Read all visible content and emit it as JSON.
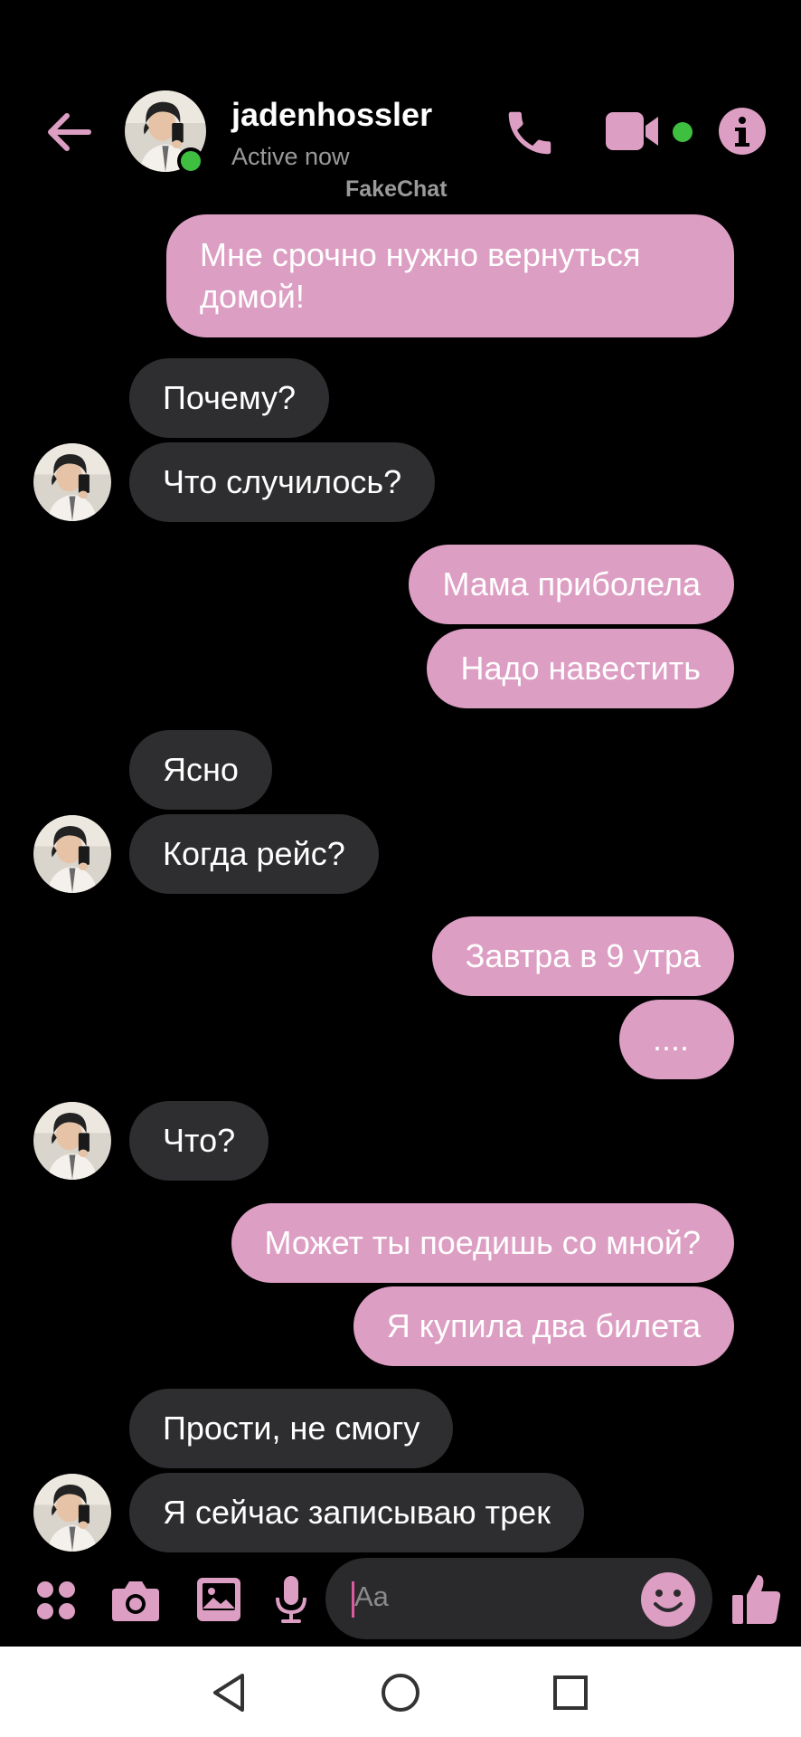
{
  "header": {
    "contact_name": "jadenhossler",
    "status": "Active now",
    "watermark": "FakeChat",
    "icons": [
      "back-arrow-icon",
      "phone-icon",
      "video-camera-icon",
      "info-icon"
    ]
  },
  "messages": [
    {
      "side": "out",
      "text": "Мне срочно нужно вернуться домой!"
    },
    {
      "side": "in",
      "text": "Почему?"
    },
    {
      "side": "in",
      "text": "Что случилось?"
    },
    {
      "side": "out",
      "text": "Мама приболела"
    },
    {
      "side": "out",
      "text": "Надо навестить"
    },
    {
      "side": "in",
      "text": "Ясно"
    },
    {
      "side": "in",
      "text": "Когда рейс?"
    },
    {
      "side": "out",
      "text": "Завтра в 9 утра"
    },
    {
      "side": "out",
      "text": "...."
    },
    {
      "side": "in",
      "text": "Что?"
    },
    {
      "side": "out",
      "text": "Может ты поедишь со мной?"
    },
    {
      "side": "out",
      "text": "Я купила два билета"
    },
    {
      "side": "in",
      "text": "Прости, не смогу"
    },
    {
      "side": "in",
      "text": "Я сейчас записываю трек"
    }
  ],
  "composer": {
    "placeholder": "Aa",
    "icons": [
      "apps-grid-icon",
      "camera-icon",
      "image-icon",
      "microphone-icon",
      "emoji-icon",
      "thumbs-up-icon"
    ]
  },
  "navbar": {
    "icons": [
      "nav-back-icon",
      "nav-home-icon",
      "nav-recents-icon"
    ]
  },
  "colors": {
    "accent": "#dd9ec3",
    "outgoing_bubble": "#dd9ec3",
    "incoming_bubble": "#2e2e30",
    "online": "#3fbf3f",
    "background": "#000000"
  }
}
